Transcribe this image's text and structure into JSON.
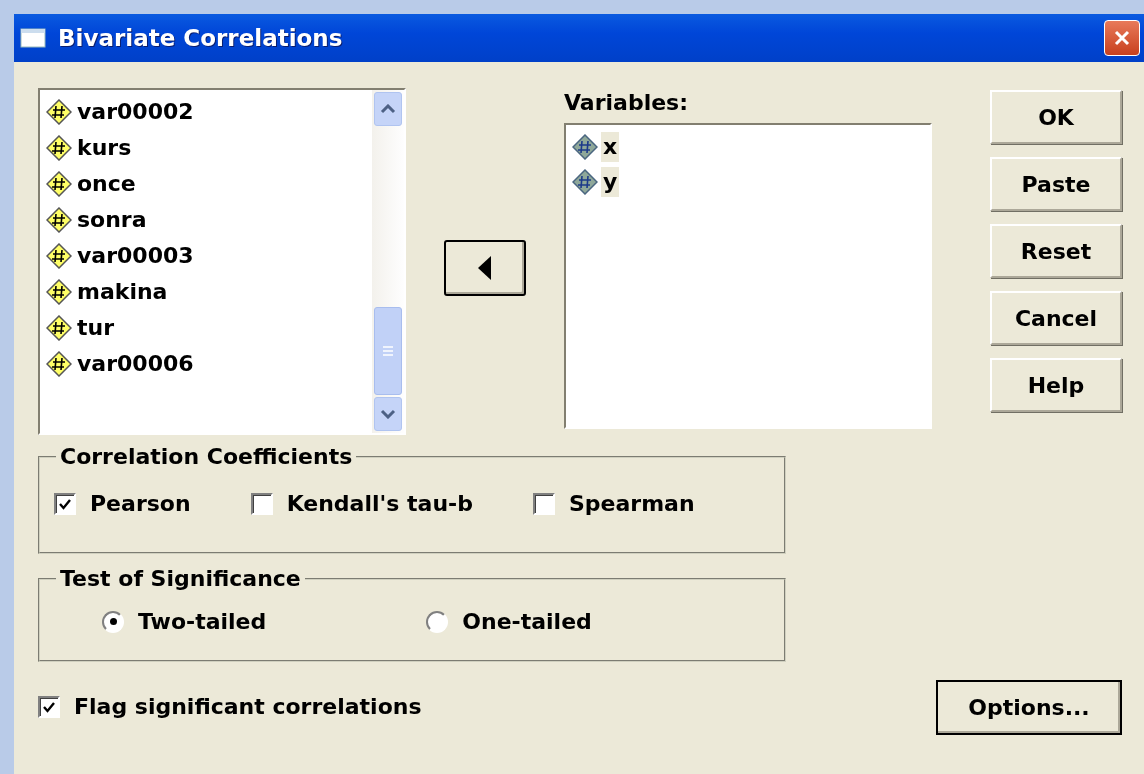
{
  "window": {
    "title": "Bivariate Correlations"
  },
  "source_list": {
    "items": [
      {
        "label": "var00002",
        "selected": false
      },
      {
        "label": "kurs",
        "selected": false
      },
      {
        "label": "once",
        "selected": false
      },
      {
        "label": "sonra",
        "selected": false
      },
      {
        "label": "var00003",
        "selected": false
      },
      {
        "label": "makina",
        "selected": false
      },
      {
        "label": "tur",
        "selected": false
      },
      {
        "label": "var00006",
        "selected": false
      }
    ]
  },
  "variables": {
    "label": "Variables:",
    "items": [
      {
        "label": "x",
        "selected": true
      },
      {
        "label": "y",
        "selected": true
      }
    ]
  },
  "buttons": [
    "OK",
    "Paste",
    "Reset",
    "Cancel",
    "Help"
  ],
  "correlation_coefficients": {
    "title": "Correlation Coefficients",
    "options": [
      {
        "label": "Pearson",
        "checked": true
      },
      {
        "label": "Kendall's tau-b",
        "checked": false
      },
      {
        "label": "Spearman",
        "checked": false
      }
    ]
  },
  "test_of_significance": {
    "title": "Test of Significance",
    "options": [
      {
        "label": "Two-tailed",
        "selected": true
      },
      {
        "label": "One-tailed",
        "selected": false
      }
    ]
  },
  "flag": {
    "label": "Flag significant correlations",
    "checked": true
  },
  "options_button": "Options..."
}
